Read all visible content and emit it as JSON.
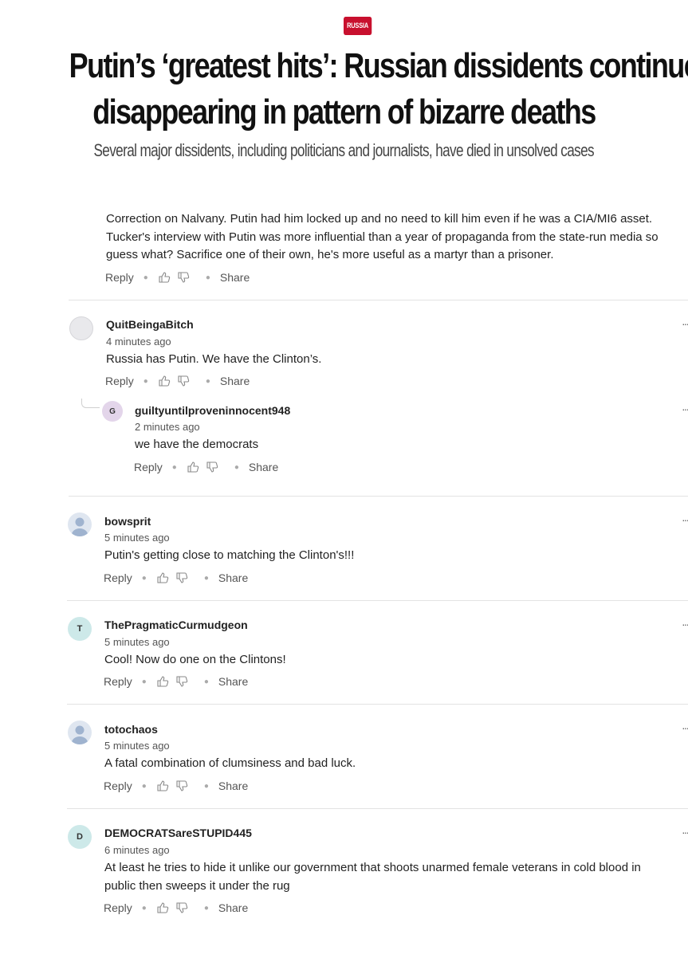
{
  "article": {
    "tag": "RUSSIA",
    "headline_line1": "Putin’s ‘greatest hits’: Russian dissidents continue",
    "headline_line2": "disappearing in pattern of bizarre deaths",
    "subheadline": "Several major dissidents, including politicians and journalists, have died in unsolved cases"
  },
  "actions": {
    "reply": "Reply",
    "share": "Share",
    "more": "···"
  },
  "comments": [
    {
      "id": "c0",
      "body_lines": [
        "Correction on Nalvany.  Putin had him locked up and no need to kill him even if he was a CIA/MI6 asset.",
        "Tucker's interview with Putin was more influential than a year of propaganda from the state-run media so",
        "guess what?   Sacrifice one of their own, he's more useful as a martyr than a prisoner."
      ]
    },
    {
      "id": "c1",
      "username": "QuitBeingaBitch",
      "time": "4 minutes ago",
      "body": "Russia has Putin. We have the Clinton’s.",
      "avatar": "ghost"
    },
    {
      "id": "c1r",
      "username": "guiltyuntilproveninnocent948",
      "time": "2 minutes ago",
      "body": "we have the democrats",
      "avatar_letter": "G"
    },
    {
      "id": "c2",
      "username": "bowsprit",
      "time": "5 minutes ago",
      "body": "Putin's getting close to matching the Clinton's!!!",
      "avatar": "person"
    },
    {
      "id": "c3",
      "username": "ThePragmaticCurmudgeon",
      "time": "5 minutes ago",
      "body": "Cool! Now do one on the Clintons!",
      "avatar_letter": "T"
    },
    {
      "id": "c4",
      "username": "totochaos",
      "time": "5 minutes ago",
      "body": "A fatal combination of clumsiness and bad luck.",
      "avatar": "person"
    },
    {
      "id": "c5",
      "username": "DEMOCRATSareSTUPID445",
      "time": "6 minutes ago",
      "avatar_letter": "D",
      "body_lines": [
        "At least he tries to hide it unlike our government that shoots unarmed female veterans in cold blood in",
        "public then sweeps it under the rug"
      ]
    }
  ],
  "colors": {
    "tag_bg": "#c8102e",
    "divider": "#e3e3e3"
  }
}
